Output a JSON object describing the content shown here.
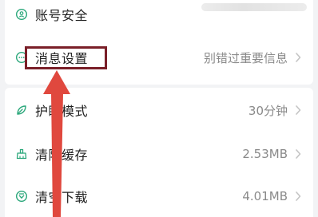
{
  "settings": {
    "items": [
      {
        "label": "账号安全",
        "value": "",
        "icon": "account-security-icon"
      },
      {
        "label": "消息设置",
        "value": "别错过重要信息",
        "icon": "message-icon"
      },
      {
        "label": "护眼模式",
        "value": "30分钟",
        "icon": "eye-protect-icon"
      },
      {
        "label": "清除缓存",
        "value": "2.53MB",
        "icon": "broom-icon"
      },
      {
        "label": "清空下载",
        "value": "4.01MB",
        "icon": "download-clear-icon"
      }
    ]
  },
  "annotation": {
    "highlight_color": "#7a1f28",
    "arrow_color": "#e0483e"
  },
  "colors": {
    "icon_green": "#2aa77a",
    "background": "#f2f3f5"
  }
}
